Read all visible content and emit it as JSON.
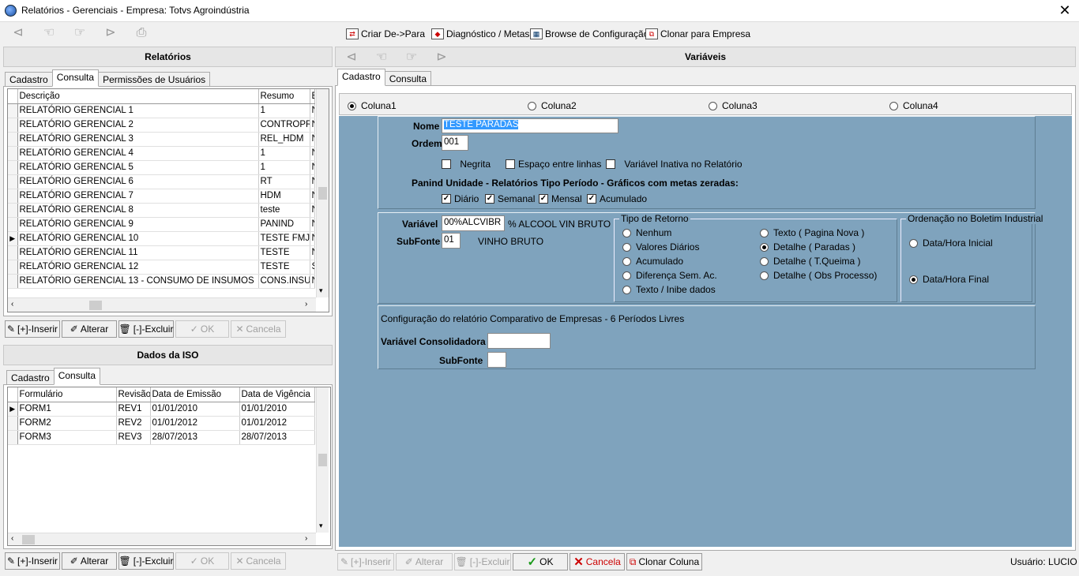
{
  "window": {
    "title": "Relatórios - Gerenciais  -  Empresa: Totvs Agroindústria",
    "close": "✕"
  },
  "toolbar": {
    "criar_de_para": "Criar De->Para",
    "diagnostico": "Diagnóstico / Metas",
    "browse": "Browse de Configuração",
    "clonar_empresa": "Clonar para Empresa"
  },
  "relatorios": {
    "header": "Relatórios",
    "tabs": [
      "Cadastro",
      "Consulta",
      "Permissões de Usuários"
    ],
    "columns": [
      "Descrição",
      "Resumo",
      "E"
    ],
    "rows": [
      {
        "descricao": "RELATÓRIO GERENCIAL 1",
        "resumo": "1",
        "e": "N"
      },
      {
        "descricao": "RELATÓRIO GERENCIAL 2",
        "resumo": "CONTROPR",
        "e": "N"
      },
      {
        "descricao": "RELATÓRIO GERENCIAL 3",
        "resumo": "REL_HDM",
        "e": "N"
      },
      {
        "descricao": "RELATÓRIO GERENCIAL 4",
        "resumo": "1",
        "e": "N"
      },
      {
        "descricao": "RELATÓRIO GERENCIAL 5",
        "resumo": "1",
        "e": "N"
      },
      {
        "descricao": "RELATÓRIO GERENCIAL 6",
        "resumo": "RT",
        "e": "N"
      },
      {
        "descricao": "RELATÓRIO GERENCIAL 7",
        "resumo": "HDM",
        "e": "N"
      },
      {
        "descricao": "RELATÓRIO GERENCIAL 8",
        "resumo": "teste",
        "e": "N"
      },
      {
        "descricao": "RELATÓRIO GERENCIAL 9",
        "resumo": "PANIND",
        "e": "N"
      },
      {
        "descricao": "RELATÓRIO GERENCIAL 10",
        "resumo": "TESTE FMJ",
        "e": "N"
      },
      {
        "descricao": "RELATÓRIO GERENCIAL 11",
        "resumo": "TESTE",
        "e": "N"
      },
      {
        "descricao": "RELATÓRIO GERENCIAL 12",
        "resumo": "TESTE",
        "e": "S"
      },
      {
        "descricao": "RELATÓRIO GERENCIAL 13 - CONSUMO DE INSUMOS",
        "resumo": "CONS.INSUM",
        "e": "N"
      }
    ],
    "selected_row": 9,
    "buttons": {
      "inserir": "[+]-Inserir",
      "alterar": "Alterar",
      "excluir": "[-]-Excluir",
      "ok": "OK",
      "cancela": "Cancela"
    }
  },
  "iso": {
    "header": "Dados da ISO",
    "tabs": [
      "Cadastro",
      "Consulta"
    ],
    "columns": [
      "Formulário",
      "Revisão",
      "Data de Emissão",
      "Data de Vigência"
    ],
    "rows": [
      {
        "form": "FORM1",
        "rev": "REV1",
        "emissao": "01/01/2010",
        "vigencia": "01/01/2010"
      },
      {
        "form": "FORM2",
        "rev": "REV2",
        "emissao": "01/01/2012",
        "vigencia": "01/01/2012"
      },
      {
        "form": "FORM3",
        "rev": "REV3",
        "emissao": "28/07/2013",
        "vigencia": "28/07/2013"
      }
    ],
    "buttons": {
      "inserir": "[+]-Inserir",
      "alterar": "Alterar",
      "excluir": "[-]-Excluir",
      "ok": "OK",
      "cancela": "Cancela"
    }
  },
  "variaveis": {
    "header": "Variáveis",
    "tabs": [
      "Cadastro",
      "Consulta"
    ],
    "colunas": [
      "Coluna1",
      "Coluna2",
      "Coluna3",
      "Coluna4"
    ],
    "nome_label": "Nome",
    "nome_value": "TESTE PARADAS",
    "ordem_label": "Ordem",
    "ordem_value": "001",
    "opts": {
      "negrita": "Negrita",
      "espaco": "Espaço entre linhas",
      "inativa": "Variável Inativa no Relatório"
    },
    "panind_label": "Panind Unidade - Relatórios Tipo Período - Gráficos com metas zeradas:",
    "periodos": [
      "Diário",
      "Semanal",
      "Mensal",
      "Acumulado"
    ],
    "variavel_label": "Variável",
    "variavel_value": "00%ALCVIBR",
    "variavel_desc": "% ALCOOL VIN BRUTO",
    "subfonte_label": "SubFonte",
    "subfonte_value": "01",
    "subfonte_desc": "VINHO BRUTO",
    "tipo_retorno": {
      "title": "Tipo de Retorno",
      "left": [
        "Nenhum",
        "Valores Diários",
        "Acumulado",
        "Diferença Sem. Ac.",
        "Texto / Inibe dados"
      ],
      "right": [
        "Texto ( Pagina Nova )",
        "Detalhe ( Paradas )",
        "Detalhe ( T.Queima )",
        "Detalhe ( Obs Processo)"
      ]
    },
    "ordenacao": {
      "title": "Ordenação no Boletim Industrial",
      "inicial": "Data/Hora Inicial",
      "final": "Data/Hora Final"
    },
    "comparativo_title": "Configuração do relatório Comparativo de Empresas - 6 Períodos Livres",
    "consolidada_label": "Variável Consolidadora",
    "subfonte2_label": "SubFonte",
    "buttons": {
      "inserir": "[+]-Inserir",
      "alterar": "Alterar",
      "excluir": "[-]-Excluir",
      "ok": "OK",
      "cancela": "Cancela",
      "clonar": "Clonar Coluna"
    }
  },
  "status": {
    "usuario": "Usuário: LUCIO"
  }
}
